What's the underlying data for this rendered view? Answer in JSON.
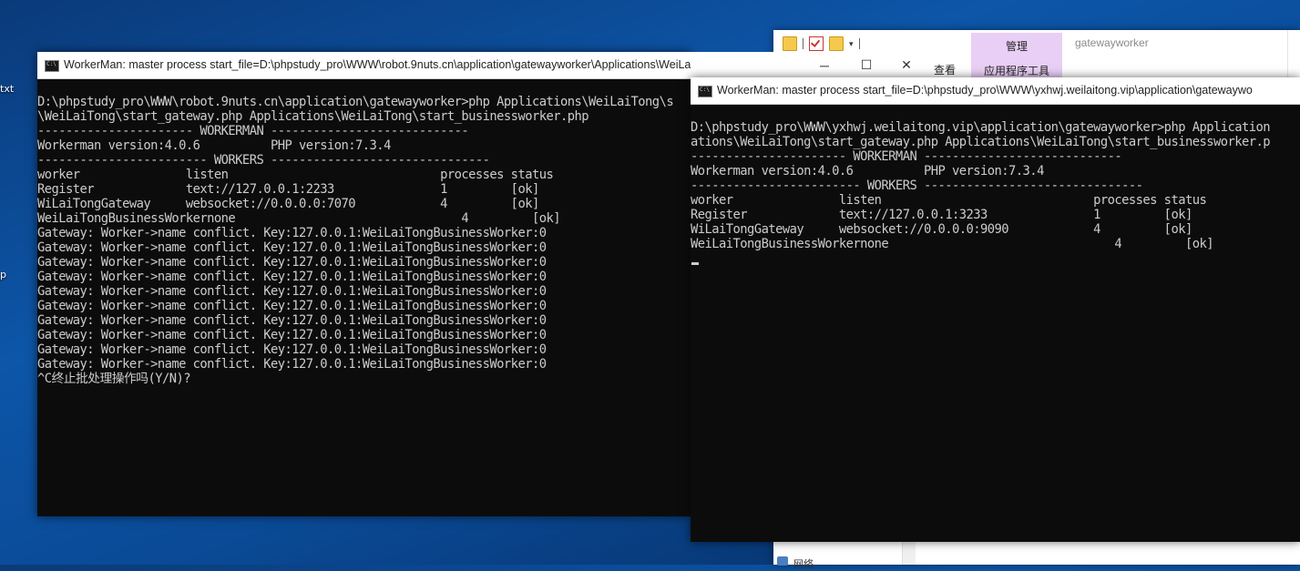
{
  "desktop": {
    "labels": [
      "txt",
      "p"
    ]
  },
  "explorer": {
    "manage_tab": "管理",
    "app_tools": "应用程序工具",
    "view_tab": "查看",
    "title": "gatewayworker",
    "network": "网络"
  },
  "console1": {
    "title": "WorkerMan: master process  start_file=D:\\phpstudy_pro\\WWW\\robot.9nuts.cn\\application\\gatewayworker\\Applications\\WeiLaiTong\\star...",
    "lines": [
      "D:\\phpstudy_pro\\WWW\\robot.9nuts.cn\\application\\gatewayworker>php Applications\\WeiLaiTong\\s",
      "\\WeiLaiTong\\start_gateway.php Applications\\WeiLaiTong\\start_businessworker.php",
      "---------------------- WORKERMAN ----------------------------",
      "Workerman version:4.0.6          PHP version:7.3.4",
      "------------------------ WORKERS -------------------------------",
      "worker               listen                              processes status",
      "Register             text://127.0.0.1:2233               1         [ok]",
      "WiLaiTongGateway     websocket://0.0.0.0:7070            4         [ok]",
      "WeiLaiTongBusinessWorkernone                                4         [ok]",
      "Gateway: Worker->name conflict. Key:127.0.0.1:WeiLaiTongBusinessWorker:0",
      "Gateway: Worker->name conflict. Key:127.0.0.1:WeiLaiTongBusinessWorker:0",
      "Gateway: Worker->name conflict. Key:127.0.0.1:WeiLaiTongBusinessWorker:0",
      "Gateway: Worker->name conflict. Key:127.0.0.1:WeiLaiTongBusinessWorker:0",
      "Gateway: Worker->name conflict. Key:127.0.0.1:WeiLaiTongBusinessWorker:0",
      "Gateway: Worker->name conflict. Key:127.0.0.1:WeiLaiTongBusinessWorker:0",
      "Gateway: Worker->name conflict. Key:127.0.0.1:WeiLaiTongBusinessWorker:0",
      "Gateway: Worker->name conflict. Key:127.0.0.1:WeiLaiTongBusinessWorker:0",
      "Gateway: Worker->name conflict. Key:127.0.0.1:WeiLaiTongBusinessWorker:0",
      "Gateway: Worker->name conflict. Key:127.0.0.1:WeiLaiTongBusinessWorker:0",
      "^C终止批处理操作吗(Y/N)?"
    ]
  },
  "console2": {
    "title": "WorkerMan: master process  start_file=D:\\phpstudy_pro\\WWW\\yxhwj.weilaitong.vip\\application\\gatewaywo",
    "lines": [
      "D:\\phpstudy_pro\\WWW\\yxhwj.weilaitong.vip\\application\\gatewayworker>php Application",
      "ations\\WeiLaiTong\\start_gateway.php Applications\\WeiLaiTong\\start_businessworker.p",
      "---------------------- WORKERMAN ----------------------------",
      "Workerman version:4.0.6          PHP version:7.3.4",
      "------------------------ WORKERS -------------------------------",
      "worker               listen                              processes status",
      "Register             text://127.0.0.1:3233               1         [ok]",
      "WiLaiTongGateway     websocket://0.0.0.0:9090            4         [ok]",
      "WeiLaiTongBusinessWorkernone                                4         [ok]"
    ]
  }
}
